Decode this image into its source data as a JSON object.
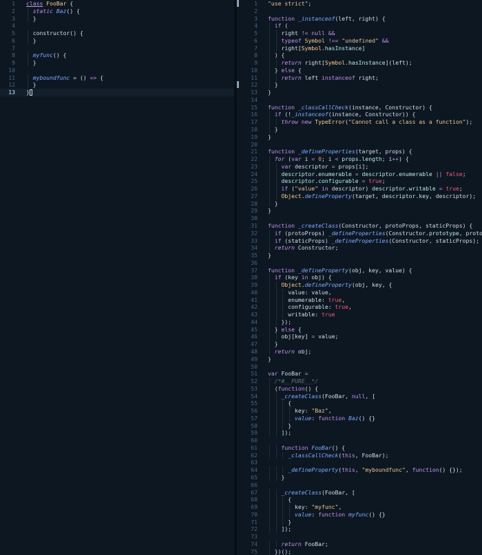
{
  "colors": {
    "background": "#0c1722",
    "keyword": "#c792ea",
    "class_name": "#ffcb8b",
    "function_name": "#82aaff",
    "string": "#ecc48d",
    "number": "#f78c6c",
    "boolean": "#ff5874",
    "comment": "#637777",
    "property": "#baebe2",
    "text": "#d6deeb",
    "line_number": "#4b6479"
  },
  "left_editor": {
    "current_line": 13,
    "lines": [
      [
        [
          "class",
          "kw-ul"
        ],
        [
          " ",
          "plain"
        ],
        [
          "FooBar",
          "cls"
        ],
        [
          " {",
          "plain"
        ]
      ],
      [
        [
          "  ",
          "plain"
        ],
        [
          "static",
          "kw-i"
        ],
        [
          " ",
          "plain"
        ],
        [
          "Baz",
          "fn"
        ],
        [
          "() {",
          "plain"
        ]
      ],
      [
        [
          "  }",
          "plain"
        ]
      ],
      [],
      [
        [
          "  constructor() {",
          "plain"
        ]
      ],
      [
        [
          "  }",
          "plain"
        ]
      ],
      [],
      [
        [
          "  ",
          "plain"
        ],
        [
          "myfunc",
          "fn"
        ],
        [
          "() {",
          "plain"
        ]
      ],
      [
        [
          "  }",
          "plain"
        ]
      ],
      [],
      [
        [
          "  ",
          "plain"
        ],
        [
          "myboundfunc",
          "fn"
        ],
        [
          " = () ",
          "plain"
        ],
        [
          "=>",
          "op"
        ],
        [
          " {",
          "plain"
        ]
      ],
      [
        [
          "  }",
          "plain"
        ]
      ],
      [
        [
          "}",
          "plain"
        ]
      ]
    ]
  },
  "right_editor": {
    "lines": [
      [
        [
          "\"use strict\"",
          "str"
        ],
        [
          ";",
          "plain"
        ]
      ],
      [],
      [
        [
          "function",
          "kw"
        ],
        [
          " ",
          "plain"
        ],
        [
          "_instanceof",
          "fn"
        ],
        [
          "(left, right) {",
          "plain"
        ]
      ],
      [
        [
          "  ",
          "plain"
        ],
        [
          "if",
          "kw"
        ],
        [
          " (",
          "plain"
        ]
      ],
      [
        [
          "    right ",
          "plain"
        ],
        [
          "!=",
          "op"
        ],
        [
          " ",
          "plain"
        ],
        [
          "null",
          "kw"
        ],
        [
          " ",
          "plain"
        ],
        [
          "&&",
          "op"
        ]
      ],
      [
        [
          "    ",
          "plain"
        ],
        [
          "typeof",
          "kw"
        ],
        [
          " ",
          "plain"
        ],
        [
          "Symbol",
          "cls"
        ],
        [
          " ",
          "plain"
        ],
        [
          "!==",
          "op"
        ],
        [
          " ",
          "plain"
        ],
        [
          "\"undefined\"",
          "str"
        ],
        [
          " ",
          "plain"
        ],
        [
          "&&",
          "op"
        ]
      ],
      [
        [
          "    right[",
          "plain"
        ],
        [
          "Symbol",
          "cls"
        ],
        [
          ".",
          "plain"
        ],
        [
          "hasInstance",
          "prop"
        ],
        [
          "]",
          "plain"
        ]
      ],
      [
        [
          "  ) {",
          "plain"
        ]
      ],
      [
        [
          "    ",
          "plain"
        ],
        [
          "return",
          "kw-i"
        ],
        [
          " right[",
          "plain"
        ],
        [
          "Symbol",
          "cls"
        ],
        [
          ".",
          "plain"
        ],
        [
          "hasInstance",
          "prop"
        ],
        [
          "](left);",
          "plain"
        ]
      ],
      [
        [
          "  } ",
          "plain"
        ],
        [
          "else",
          "kw"
        ],
        [
          " {",
          "plain"
        ]
      ],
      [
        [
          "    ",
          "plain"
        ],
        [
          "return",
          "kw-i"
        ],
        [
          " left ",
          "plain"
        ],
        [
          "instanceof",
          "kw"
        ],
        [
          " right;",
          "plain"
        ]
      ],
      [
        [
          "  }",
          "plain"
        ]
      ],
      [
        [
          "}",
          "plain"
        ]
      ],
      [],
      [
        [
          "function",
          "kw"
        ],
        [
          " ",
          "plain"
        ],
        [
          "_classCallCheck",
          "fn"
        ],
        [
          "(instance, Constructor) {",
          "plain"
        ]
      ],
      [
        [
          "  ",
          "plain"
        ],
        [
          "if",
          "kw"
        ],
        [
          " (!",
          "plain"
        ],
        [
          "_instanceof",
          "fn"
        ],
        [
          "(instance, Constructor)) {",
          "plain"
        ]
      ],
      [
        [
          "    ",
          "plain"
        ],
        [
          "throw",
          "kw-i"
        ],
        [
          " ",
          "plain"
        ],
        [
          "new",
          "kw"
        ],
        [
          " ",
          "plain"
        ],
        [
          "TypeError",
          "cls"
        ],
        [
          "(",
          "plain"
        ],
        [
          "\"Cannot call a class as a function\"",
          "str"
        ],
        [
          ");",
          "plain"
        ]
      ],
      [
        [
          "  }",
          "plain"
        ]
      ],
      [
        [
          "}",
          "plain"
        ]
      ],
      [],
      [
        [
          "function",
          "kw"
        ],
        [
          " ",
          "plain"
        ],
        [
          "_defineProperties",
          "fn"
        ],
        [
          "(target, props) {",
          "plain"
        ]
      ],
      [
        [
          "  ",
          "plain"
        ],
        [
          "for",
          "kw-i"
        ],
        [
          " (",
          "plain"
        ],
        [
          "var",
          "kw"
        ],
        [
          " i ",
          "plain"
        ],
        [
          "=",
          "op"
        ],
        [
          " ",
          "plain"
        ],
        [
          "0",
          "num"
        ],
        [
          "; i ",
          "plain"
        ],
        [
          "<",
          "op"
        ],
        [
          " ",
          "plain"
        ],
        [
          "props",
          "prop"
        ],
        [
          ".",
          "plain"
        ],
        [
          "length",
          "prop"
        ],
        [
          "; i",
          "plain"
        ],
        [
          "++",
          "op"
        ],
        [
          ") {",
          "plain"
        ]
      ],
      [
        [
          "    ",
          "plain"
        ],
        [
          "var",
          "kw"
        ],
        [
          " descriptor ",
          "plain"
        ],
        [
          "=",
          "op"
        ],
        [
          " props[i];",
          "plain"
        ]
      ],
      [
        [
          "    ",
          "plain"
        ],
        [
          "descriptor",
          "prop"
        ],
        [
          ".",
          "plain"
        ],
        [
          "enumerable",
          "prop"
        ],
        [
          " ",
          "plain"
        ],
        [
          "=",
          "op"
        ],
        [
          " ",
          "plain"
        ],
        [
          "descriptor",
          "prop"
        ],
        [
          ".",
          "plain"
        ],
        [
          "enumerable",
          "prop"
        ],
        [
          " ",
          "plain"
        ],
        [
          "||",
          "op"
        ],
        [
          " ",
          "plain"
        ],
        [
          "false",
          "bool"
        ],
        [
          ";",
          "plain"
        ]
      ],
      [
        [
          "    ",
          "plain"
        ],
        [
          "descriptor",
          "prop"
        ],
        [
          ".",
          "plain"
        ],
        [
          "configurable",
          "prop"
        ],
        [
          " ",
          "plain"
        ],
        [
          "=",
          "op"
        ],
        [
          " ",
          "plain"
        ],
        [
          "true",
          "bool"
        ],
        [
          ";",
          "plain"
        ]
      ],
      [
        [
          "    ",
          "plain"
        ],
        [
          "if",
          "kw"
        ],
        [
          " (",
          "plain"
        ],
        [
          "\"value\"",
          "str"
        ],
        [
          " ",
          "plain"
        ],
        [
          "in",
          "kw"
        ],
        [
          " descriptor) ",
          "plain"
        ],
        [
          "descriptor",
          "prop"
        ],
        [
          ".",
          "plain"
        ],
        [
          "writable",
          "prop"
        ],
        [
          " ",
          "plain"
        ],
        [
          "=",
          "op"
        ],
        [
          " ",
          "plain"
        ],
        [
          "true",
          "bool"
        ],
        [
          ";",
          "plain"
        ]
      ],
      [
        [
          "    ",
          "plain"
        ],
        [
          "Object",
          "cls"
        ],
        [
          ".",
          "plain"
        ],
        [
          "defineProperty",
          "fn"
        ],
        [
          "(target, ",
          "plain"
        ],
        [
          "descriptor",
          "prop"
        ],
        [
          ".",
          "plain"
        ],
        [
          "key",
          "prop"
        ],
        [
          ", descriptor);",
          "plain"
        ]
      ],
      [
        [
          "  }",
          "plain"
        ]
      ],
      [
        [
          "}",
          "plain"
        ]
      ],
      [],
      [
        [
          "function",
          "kw"
        ],
        [
          " ",
          "plain"
        ],
        [
          "_createClass",
          "fn"
        ],
        [
          "(Constructor, protoProps, staticProps) {",
          "plain"
        ]
      ],
      [
        [
          "  ",
          "plain"
        ],
        [
          "if",
          "kw"
        ],
        [
          " (protoProps) ",
          "plain"
        ],
        [
          "_defineProperties",
          "fn"
        ],
        [
          "(Constructor.",
          "plain"
        ],
        [
          "prototype",
          "prop"
        ],
        [
          ", protoProps);",
          "plain"
        ]
      ],
      [
        [
          "  ",
          "plain"
        ],
        [
          "if",
          "kw"
        ],
        [
          " (staticProps) ",
          "plain"
        ],
        [
          "_defineProperties",
          "fn"
        ],
        [
          "(Constructor, staticProps);",
          "plain"
        ]
      ],
      [
        [
          "  ",
          "plain"
        ],
        [
          "return",
          "kw-i"
        ],
        [
          " Constructor;",
          "plain"
        ]
      ],
      [
        [
          "}",
          "plain"
        ]
      ],
      [],
      [
        [
          "function",
          "kw"
        ],
        [
          " ",
          "plain"
        ],
        [
          "_defineProperty",
          "fn"
        ],
        [
          "(obj, key, value) {",
          "plain"
        ]
      ],
      [
        [
          "  ",
          "plain"
        ],
        [
          "if",
          "kw"
        ],
        [
          " (key ",
          "plain"
        ],
        [
          "in",
          "kw"
        ],
        [
          " obj) {",
          "plain"
        ]
      ],
      [
        [
          "    ",
          "plain"
        ],
        [
          "Object",
          "cls"
        ],
        [
          ".",
          "plain"
        ],
        [
          "defineProperty",
          "fn"
        ],
        [
          "(obj, key, {",
          "plain"
        ]
      ],
      [
        [
          "      value: value,",
          "plain"
        ]
      ],
      [
        [
          "      enumerable: ",
          "plain"
        ],
        [
          "true",
          "bool"
        ],
        [
          ",",
          "plain"
        ]
      ],
      [
        [
          "      configurable: ",
          "plain"
        ],
        [
          "true",
          "bool"
        ],
        [
          ",",
          "plain"
        ]
      ],
      [
        [
          "      writable: ",
          "plain"
        ],
        [
          "true",
          "bool"
        ]
      ],
      [
        [
          "    });",
          "plain"
        ]
      ],
      [
        [
          "  } ",
          "plain"
        ],
        [
          "else",
          "kw"
        ],
        [
          " {",
          "plain"
        ]
      ],
      [
        [
          "    obj[key] ",
          "plain"
        ],
        [
          "=",
          "op"
        ],
        [
          " value;",
          "plain"
        ]
      ],
      [
        [
          "  }",
          "plain"
        ]
      ],
      [
        [
          "  ",
          "plain"
        ],
        [
          "return",
          "kw-i"
        ],
        [
          " obj;",
          "plain"
        ]
      ],
      [
        [
          "}",
          "plain"
        ]
      ],
      [],
      [
        [
          "var",
          "kw"
        ],
        [
          " FooBar ",
          "plain"
        ],
        [
          "=",
          "op"
        ]
      ],
      [
        [
          "  ",
          "plain"
        ],
        [
          "/*#__PURE__*/",
          "com"
        ]
      ],
      [
        [
          "  (",
          "plain"
        ],
        [
          "function",
          "kw"
        ],
        [
          "() {",
          "plain"
        ]
      ],
      [
        [
          "    ",
          "plain"
        ],
        [
          "_createClass",
          "fn"
        ],
        [
          "(FooBar, ",
          "plain"
        ],
        [
          "null",
          "kw"
        ],
        [
          ", [",
          "plain"
        ]
      ],
      [
        [
          "      {",
          "plain"
        ]
      ],
      [
        [
          "        key: ",
          "plain"
        ],
        [
          "\"Baz\"",
          "str"
        ],
        [
          ",",
          "plain"
        ]
      ],
      [
        [
          "        ",
          "plain"
        ],
        [
          "value",
          "fn"
        ],
        [
          ": ",
          "plain"
        ],
        [
          "function",
          "kw"
        ],
        [
          " ",
          "plain"
        ],
        [
          "Baz",
          "fn"
        ],
        [
          "() {}",
          "plain"
        ]
      ],
      [
        [
          "      }",
          "plain"
        ]
      ],
      [
        [
          "    ]);",
          "plain"
        ]
      ],
      [],
      [
        [
          "    ",
          "plain"
        ],
        [
          "function",
          "kw"
        ],
        [
          " ",
          "plain"
        ],
        [
          "FooBar",
          "fn"
        ],
        [
          "() {",
          "plain"
        ]
      ],
      [
        [
          "      ",
          "plain"
        ],
        [
          "_classCallCheck",
          "fn"
        ],
        [
          "(",
          "plain"
        ],
        [
          "this",
          "kw"
        ],
        [
          ", FooBar);",
          "plain"
        ]
      ],
      [],
      [
        [
          "      ",
          "plain"
        ],
        [
          "_defineProperty",
          "fn"
        ],
        [
          "(",
          "plain"
        ],
        [
          "this",
          "kw"
        ],
        [
          ", ",
          "plain"
        ],
        [
          "\"myboundfunc\"",
          "str"
        ],
        [
          ", ",
          "plain"
        ],
        [
          "function",
          "kw"
        ],
        [
          "() {});",
          "plain"
        ]
      ],
      [
        [
          "    }",
          "plain"
        ]
      ],
      [],
      [
        [
          "    ",
          "plain"
        ],
        [
          "_createClass",
          "fn"
        ],
        [
          "(FooBar, [",
          "plain"
        ]
      ],
      [
        [
          "      {",
          "plain"
        ]
      ],
      [
        [
          "        key: ",
          "plain"
        ],
        [
          "\"myfunc\"",
          "str"
        ],
        [
          ",",
          "plain"
        ]
      ],
      [
        [
          "        ",
          "plain"
        ],
        [
          "value",
          "fn"
        ],
        [
          ": ",
          "plain"
        ],
        [
          "function",
          "kw"
        ],
        [
          " ",
          "plain"
        ],
        [
          "myfunc",
          "fn"
        ],
        [
          "() {}",
          "plain"
        ]
      ],
      [
        [
          "      }",
          "plain"
        ]
      ],
      [
        [
          "    ]);",
          "plain"
        ]
      ],
      [],
      [
        [
          "    ",
          "plain"
        ],
        [
          "return",
          "kw-i"
        ],
        [
          " FooBar;",
          "plain"
        ]
      ],
      [
        [
          "  })();",
          "plain"
        ]
      ]
    ]
  }
}
